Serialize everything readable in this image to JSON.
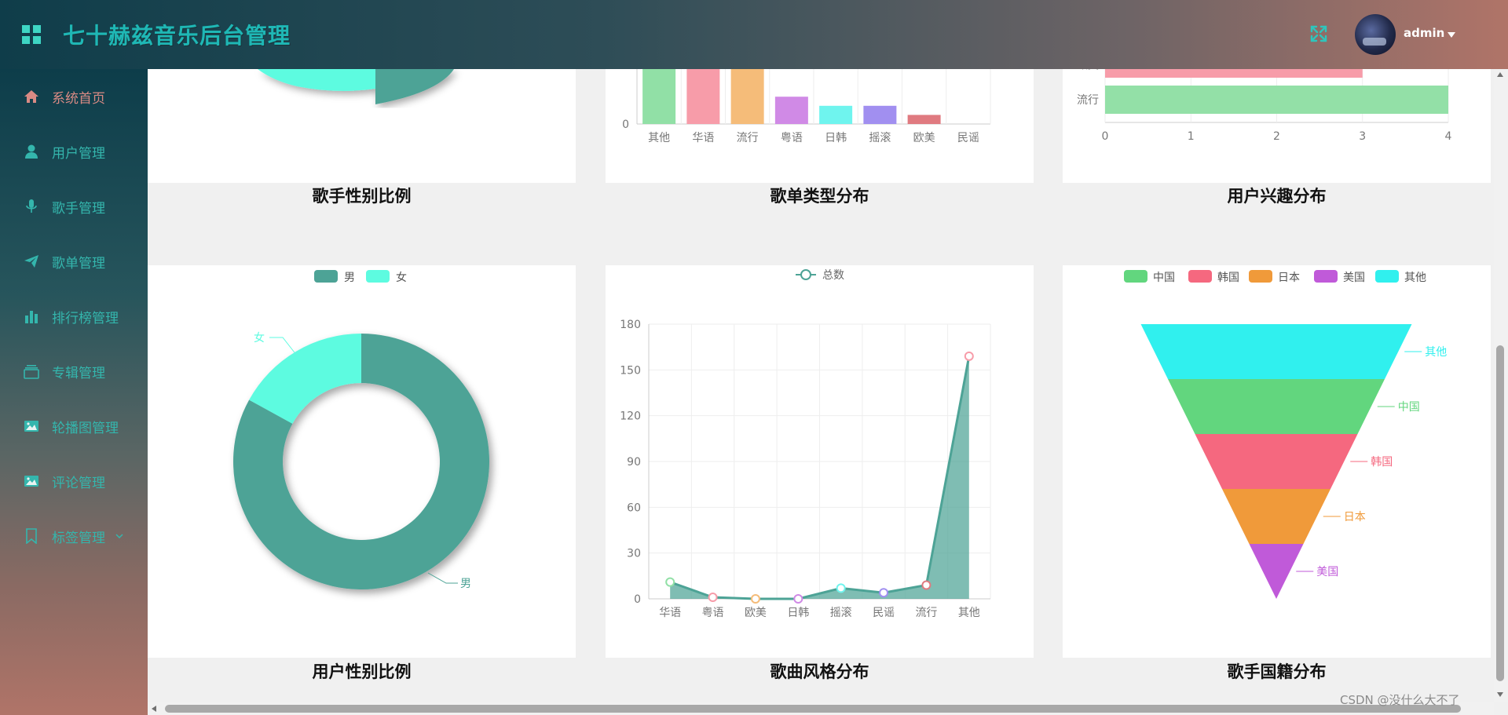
{
  "header": {
    "app_title": "七十赫兹音乐后台管理",
    "username": "admin",
    "colors": {
      "accent": "#3ed6c4"
    }
  },
  "sidebar": {
    "items": [
      {
        "label": "系统首页",
        "icon": "home-icon",
        "active": true
      },
      {
        "label": "用户管理",
        "icon": "user-icon"
      },
      {
        "label": "歌手管理",
        "icon": "microphone-icon"
      },
      {
        "label": "歌单管理",
        "icon": "paper-plane-icon"
      },
      {
        "label": "排行榜管理",
        "icon": "bar-chart-icon"
      },
      {
        "label": "专辑管理",
        "icon": "album-stack-icon"
      },
      {
        "label": "轮播图管理",
        "icon": "image-icon"
      },
      {
        "label": "评论管理",
        "icon": "image-icon"
      },
      {
        "label": "标签管理",
        "icon": "bookmark-icon",
        "has_submenu": true
      }
    ]
  },
  "captions": {
    "singer_gender": "歌手性别比例",
    "playlist_type": "歌单类型分布",
    "user_interest": "用户兴趣分布",
    "user_gender": "用户性别比例",
    "song_style": "歌曲风格分布",
    "singer_nationality": "歌手国籍分布"
  },
  "watermark": "CSDN @没什么大不了",
  "chart_data": [
    {
      "type": "pie",
      "note": "partially scrolled out of view",
      "slice_colors": [
        "#4da396",
        "#5dfbe0"
      ]
    },
    {
      "type": "bar",
      "categories": [
        "其他",
        "华语",
        "流行",
        "粤语",
        "日韩",
        "摇滚",
        "欧美",
        "民谣"
      ],
      "values": [
        14,
        14,
        14,
        6,
        4,
        4,
        2,
        0
      ],
      "colors": [
        "#91e0a6",
        "#f79ca9",
        "#f5bc79",
        "#d08ae6",
        "#6ff4ee",
        "#a18ff0",
        "#e07a80",
        "#cccccc"
      ],
      "ytick_visible": [
        "0"
      ]
    },
    {
      "type": "bar",
      "orientation": "horizontal",
      "categories": [
        "流行",
        "欧美"
      ],
      "values": [
        4,
        3
      ],
      "colors": [
        "#93e0a7",
        "#f79ca9"
      ],
      "xticks": [
        "0",
        "1",
        "2",
        "3",
        "4"
      ],
      "xlim": [
        0,
        4
      ]
    },
    {
      "type": "pie",
      "donut": true,
      "legend": [
        "男",
        "女"
      ],
      "labels": [
        "男",
        "女"
      ],
      "values": [
        83,
        17
      ],
      "colors": [
        "#4da396",
        "#5dfbe0"
      ]
    },
    {
      "type": "area",
      "legend": [
        "总数"
      ],
      "categories": [
        "华语",
        "粤语",
        "欧美",
        "日韩",
        "摇滚",
        "民谣",
        "流行",
        "其他"
      ],
      "series": [
        {
          "name": "总数",
          "values": [
            11,
            1,
            0,
            0,
            7,
            4,
            9,
            159
          ]
        }
      ],
      "ylim": [
        0,
        180
      ],
      "yticks": [
        0,
        30,
        60,
        90,
        120,
        150,
        180
      ],
      "point_colors": [
        "#91e0a6",
        "#f79ca9",
        "#f5bc79",
        "#d08ae6",
        "#6ff4ee",
        "#a18ff0",
        "#e07a80",
        "#f79ca9"
      ],
      "line_color": "#4da396"
    },
    {
      "type": "funnel",
      "legend": [
        "中国",
        "韩国",
        "日本",
        "美国",
        "其他"
      ],
      "order": [
        "其他",
        "中国",
        "韩国",
        "日本",
        "美国"
      ],
      "values": [
        100,
        80,
        60,
        40,
        20
      ],
      "colors": {
        "其他": "#30f0ee",
        "中国": "#62d67e",
        "韩国": "#f5687f",
        "日本": "#f09a3a",
        "美国": "#c05ad9"
      }
    }
  ]
}
